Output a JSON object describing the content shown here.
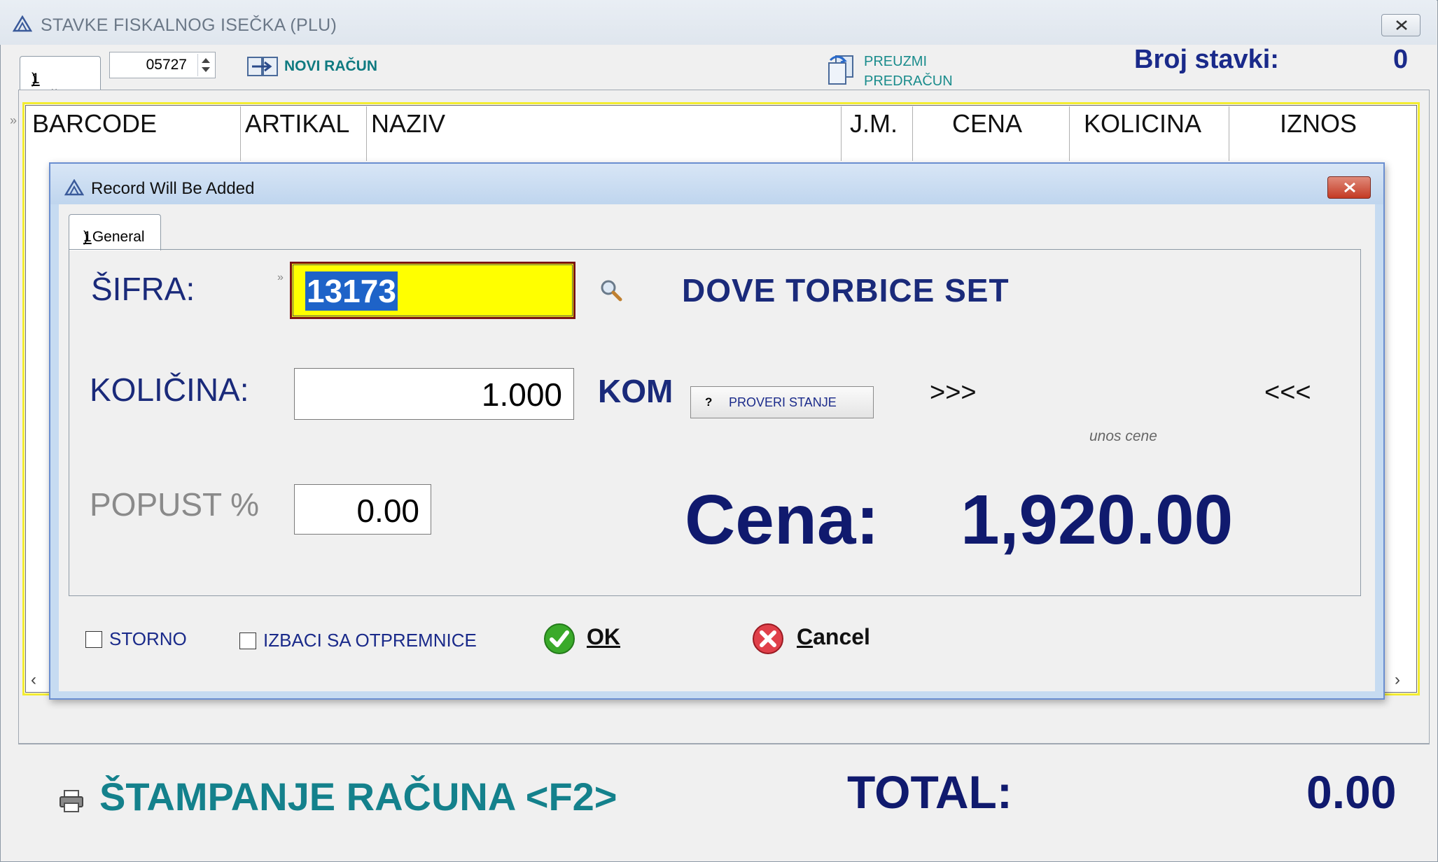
{
  "window": {
    "title": "STAVKE FISKALNOG ISEČKA (PLU)"
  },
  "toolbar": {
    "tab_number": "1",
    "tab_label": ") Račun",
    "receipt_number": "05727",
    "novi_racun_label": "NOVI RAČUN",
    "preuzmi_line1": "PREUZMI",
    "preuzmi_line2": "PREDRAČUN",
    "broj_stavki_label": "Broj stavki:",
    "broj_stavki_value": "0"
  },
  "grid": {
    "columns": [
      "BARCODE",
      "ARTIKAL",
      "NAZIV",
      "J.M.",
      "CENA",
      "KOLICINA",
      "IZNOS"
    ]
  },
  "dialog": {
    "title": "Record Will Be Added",
    "tab_number": "1",
    "tab_label": ") General",
    "sifra_label": "ŠIFRA:",
    "sifra_value": "13173",
    "artikal_name": "DOVE TORBICE SET",
    "kolicina_label": "KOLIČINA:",
    "kolicina_value": "1.000",
    "unit": "KOM",
    "proveri_q": "?",
    "proveri_label": "PROVERI STANJE",
    "arrows_right": ">>>",
    "arrows_left": "<<<",
    "unos_cene": "unos cene",
    "popust_label": "POPUST %",
    "popust_value": "0.00",
    "cena_label": "Cena:",
    "cena_value": "1,920.00",
    "storno_label": "STORNO",
    "izbaci_label": "IZBACI SA OTPREMNICE",
    "ok_label": "OK",
    "cancel_first": "C",
    "cancel_rest": "ancel"
  },
  "footer": {
    "print_label": "ŠTAMPANJE RAČUNA <F2>",
    "total_label": "TOTAL:",
    "total_value": "0.00"
  },
  "colors": {
    "accent_navy": "#101a6e",
    "teal": "#14818c",
    "highlight_yellow": "#ffff00",
    "selection_blue": "#1e63c8"
  }
}
